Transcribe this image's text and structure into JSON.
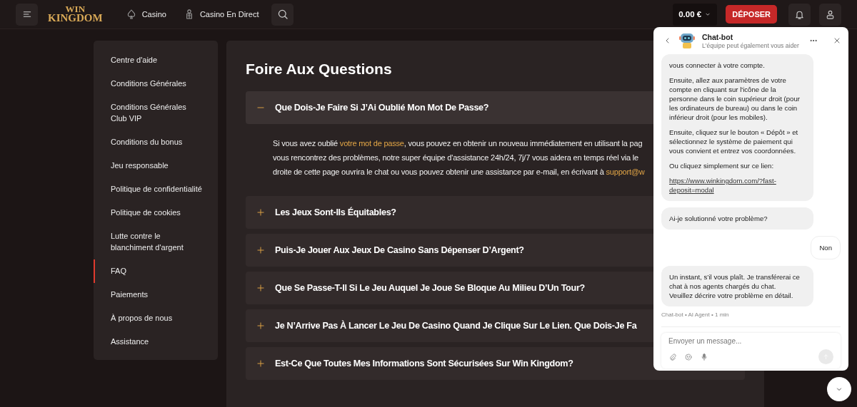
{
  "topbar": {
    "nav": [
      {
        "label": "Casino"
      },
      {
        "label": "Casino En Direct"
      }
    ],
    "logo_top": "WIN",
    "logo_bottom": "KINGDOM",
    "balance": "0.00 €",
    "deposit": "DÉPOSER"
  },
  "sidebar": {
    "items": [
      {
        "label": "Centre d'aide",
        "selected": false
      },
      {
        "label": "Conditions Générales",
        "selected": false
      },
      {
        "label": "Conditions Générales Club VIP",
        "selected": false
      },
      {
        "label": "Conditions du bonus",
        "selected": false
      },
      {
        "label": "Jeu responsable",
        "selected": false
      },
      {
        "label": "Politique de confidentialité",
        "selected": false
      },
      {
        "label": "Politique de cookies",
        "selected": false
      },
      {
        "label": "Lutte contre le blanchiment d'argent",
        "selected": false
      },
      {
        "label": "FAQ",
        "selected": true
      },
      {
        "label": "Paiements",
        "selected": false
      },
      {
        "label": "À propos de nous",
        "selected": false
      },
      {
        "label": "Assistance",
        "selected": false
      }
    ]
  },
  "faq": {
    "title": "Foire Aux Questions",
    "items": [
      {
        "question": "Que Dois-Je Faire Si J’Ai Oublié Mon Mot De Passe?",
        "expanded": true,
        "answer": [
          [
            {
              "kind": "text",
              "text": "Si vous avez oublié "
            },
            {
              "kind": "link",
              "text": "votre mot de passe"
            },
            {
              "kind": "text",
              "text": ", vous pouvez en obtenir un nouveau immédiatement en utilisant la pag"
            }
          ],
          [
            {
              "kind": "text",
              "text": "vous rencontrez des problèmes, notre super équipe d'assistance 24h/24, 7j/7 vous aidera en temps réel via le"
            }
          ],
          [
            {
              "kind": "text",
              "text": "droite de cette page ouvrira le chat ou vous pouvez obtenir une assistance par e-mail, en écrivant à "
            },
            {
              "kind": "link",
              "text": "support@w"
            }
          ]
        ]
      },
      {
        "question": "Les Jeux Sont-Ils Équitables?",
        "expanded": false
      },
      {
        "question": "Puis-Je Jouer Aux Jeux De Casino Sans Dépenser D’Argent?",
        "expanded": false
      },
      {
        "question": "Que Se Passe-T-Il Si Le Jeu Auquel Je Joue Se Bloque Au Milieu D’Un Tour?",
        "expanded": false
      },
      {
        "question": "Je N’Arrive Pas À Lancer Le Jeu De Casino Quand Je Clique Sur Le Lien. Que Dois-Je Fa",
        "expanded": false
      },
      {
        "question": "Est-Ce Que Toutes Mes Informations Sont Sécurisées Sur Win Kingdom?",
        "expanded": false
      }
    ]
  },
  "chat": {
    "name": "Chat-bot",
    "subtitle": "L'équipe peut également vous aider",
    "messages": [
      {
        "kind": "bot",
        "paragraphs": [
          {
            "kind": "text",
            "text": "vous connecter à votre compte."
          },
          {
            "kind": "text",
            "text": "Ensuite, allez aux paramètres de votre compte en cliquant sur l'icône de la personne dans le coin supérieur droit (pour les ordinateurs de bureau) ou dans le coin inférieur droit (pour les mobiles)."
          },
          {
            "kind": "text",
            "text": "Ensuite, cliquez sur le bouton « Dépôt » et sélectionnez le système de paiement qui vous convient et entrez vos coordonnées."
          },
          {
            "kind": "text",
            "text": "Ou cliquez simplement sur ce lien:"
          },
          {
            "kind": "link",
            "text": "https://www.winkingdom.com/?fast-deposit=modal"
          }
        ]
      },
      {
        "kind": "bot",
        "paragraphs": [
          {
            "kind": "text",
            "text": "Ai-je solutionné votre problème?"
          }
        ]
      },
      {
        "kind": "user",
        "paragraphs": [
          {
            "kind": "text",
            "text": "Non"
          }
        ]
      },
      {
        "kind": "bot",
        "paragraphs": [
          {
            "kind": "text",
            "text": "Un instant, s’il vous plaît. Je transférerai ce chat à nos agents chargés du chat.\nVeuillez décrire votre problème en détail."
          }
        ]
      }
    ],
    "meta": "Chat-bot • AI Agent • 1 min",
    "placeholder": "Envoyer un message..."
  }
}
